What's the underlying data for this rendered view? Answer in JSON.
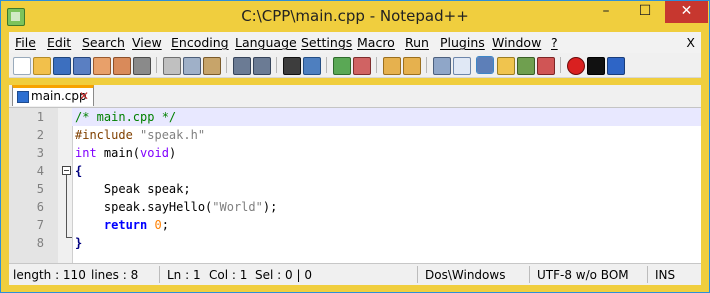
{
  "window": {
    "title": "C:\\CPP\\main.cpp - Notepad++",
    "controls": {
      "minimize": "–",
      "maximize": "☐",
      "close": "✕"
    }
  },
  "menu": {
    "items": [
      "File",
      "Edit",
      "Search",
      "View",
      "Encoding",
      "Language",
      "Settings",
      "Macro",
      "Run",
      "Plugins",
      "Window",
      "?"
    ],
    "close": "X"
  },
  "toolbar": {
    "icons": [
      "new-file-icon",
      "open-file-icon",
      "save-icon",
      "save-all-icon",
      "close-icon",
      "close-all-icon",
      "print-icon",
      "cut-icon",
      "copy-icon",
      "paste-icon",
      "undo-icon",
      "redo-icon",
      "find-icon",
      "replace-icon",
      "zoom-in-icon",
      "zoom-out-icon",
      "sync-vertical-icon",
      "sync-horizontal-icon",
      "word-wrap-icon",
      "show-all-chars-icon",
      "indent-guide-icon",
      "user-language-icon",
      "document-map-icon",
      "function-list-icon",
      "record-macro-icon",
      "stop-record-icon",
      "playback-icon"
    ]
  },
  "tab": {
    "label": "main.cpp",
    "close": "✕"
  },
  "editor": {
    "line_numbers": [
      "1",
      "2",
      "3",
      "4",
      "5",
      "6",
      "7",
      "8"
    ],
    "lines": [
      {
        "text": "/* main.cpp */"
      },
      {
        "pre": "#include ",
        "str": "\"speak.h\""
      },
      {
        "type": "int",
        "rest": " main(",
        "type2": "void",
        "end": ")"
      },
      {
        "op": "{"
      },
      {
        "text": "    Speak speak;"
      },
      {
        "pre": "    speak.sayHello(",
        "str": "\"World\"",
        "end": ");"
      },
      {
        "key": "    return",
        "mid": " ",
        "num": "0",
        "end": ";"
      },
      {
        "op": "}"
      }
    ]
  },
  "status": {
    "length": "length : 110",
    "lines": "lines : 8",
    "ln": "Ln : 1",
    "col": "Col : 1",
    "sel": "Sel : 0 | 0",
    "eol": "Dos\\Windows",
    "encoding": "UTF-8 w/o BOM",
    "mode": "INS"
  },
  "colors": {
    "titlebar": "#f0ce3e",
    "comment": "#008000",
    "keyword": "#0000ff",
    "type": "#8000ff",
    "string": "#808080",
    "number": "#ff8000",
    "current_line": "#e8e8ff"
  }
}
